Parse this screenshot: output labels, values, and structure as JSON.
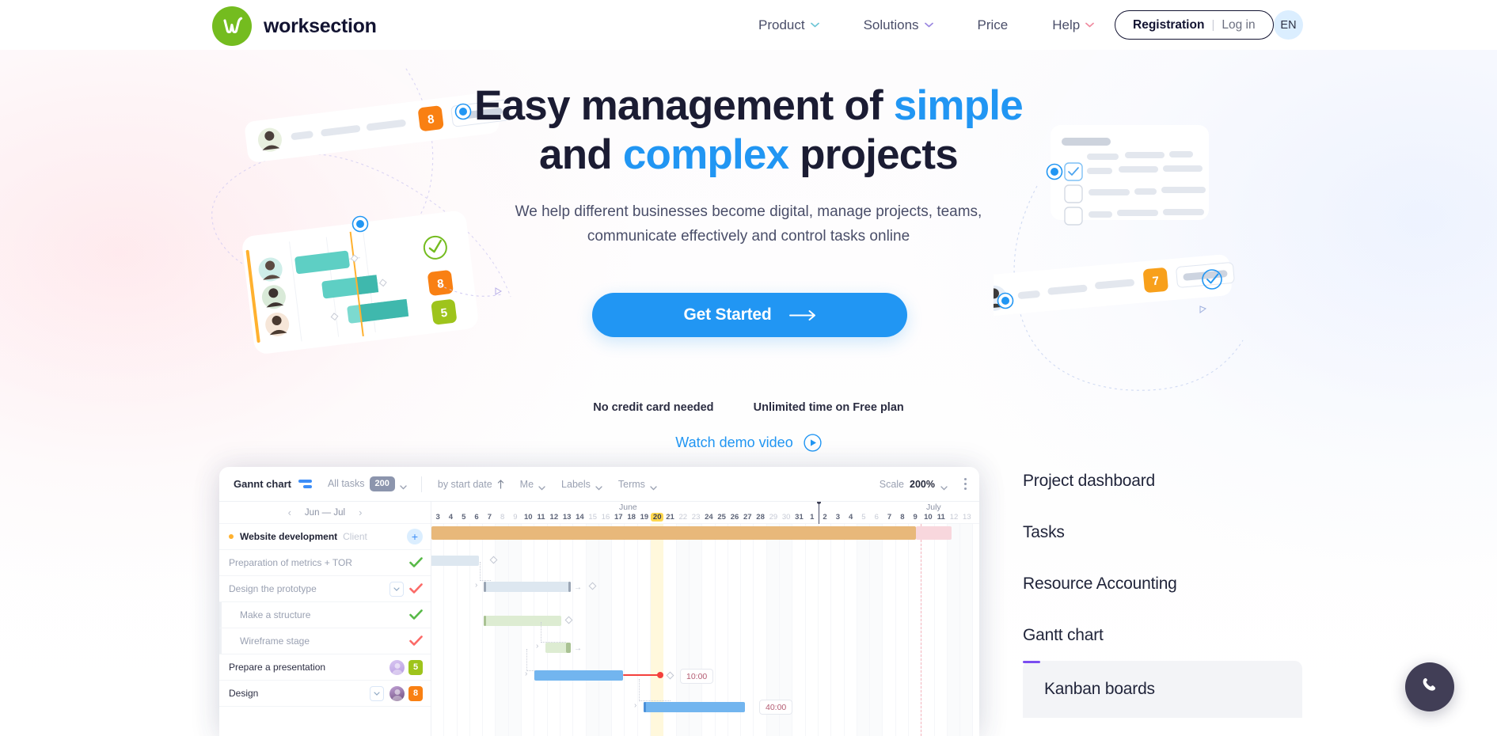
{
  "brand": {
    "name": "worksection",
    "logo_icon": "worksection-w-logo",
    "logo_color": "#74bc1f"
  },
  "nav": {
    "items": [
      {
        "label": "Product",
        "has_chevron": true,
        "chevron_color": "#6ec6d6"
      },
      {
        "label": "Solutions",
        "has_chevron": true,
        "chevron_color": "#9b87e0"
      },
      {
        "label": "Price",
        "has_chevron": false,
        "chevron_color": ""
      },
      {
        "label": "Help",
        "has_chevron": true,
        "chevron_color": "#f08ba0"
      }
    ],
    "registration_label": "Registration",
    "separator": "|",
    "login_label": "Log in",
    "language": "EN"
  },
  "hero": {
    "headline_part1": "Easy management of ",
    "headline_highlight1": "simple",
    "headline_part2": "and ",
    "headline_highlight2": "complex",
    "headline_part3": " projects",
    "highlight_color": "#2196f3",
    "subtitle_line1": "We help different businesses become digital, manage projects, teams,",
    "subtitle_line2": "communicate effectively and control tasks online",
    "cta_label": "Get Started",
    "cta_icon": "arrow-right-icon",
    "cta_color": "#2196f3",
    "note_left": "No credit card needed",
    "note_right": "Unlimited time on Free plan",
    "demo_label": "Watch demo video",
    "demo_icon": "play-circle-icon"
  },
  "illustration_left": {
    "badges": [
      "8",
      "8",
      "5"
    ],
    "badge_orange": "#f98013",
    "badge_green": "#9ec41c",
    "bar_color": "#5ecfc4",
    "check_color": "#74bc1f"
  },
  "illustration_right": {
    "badge": "7",
    "badge_color": "#f8a01b",
    "check_icon": "check-circle-icon"
  },
  "gantt": {
    "title": "Gannt chart",
    "title_icon": "gantt-bars-icon",
    "filters": [
      {
        "label": "All tasks",
        "badge": "200",
        "chevron": true
      },
      {
        "label": "by start date",
        "icon": "arrow-up-icon",
        "chevron": false
      },
      {
        "label": "Me",
        "chevron": true
      },
      {
        "label": "Labels",
        "chevron": true
      },
      {
        "label": "Terms",
        "chevron": true
      }
    ],
    "scale_label": "Scale",
    "scale_value": "200%",
    "menu_icon": "kebab-menu-icon",
    "date_nav": {
      "prev_icon": "chevron-left-icon",
      "range": "Jun — Jul",
      "next_icon": "chevron-right-icon"
    },
    "months": [
      {
        "name": "June"
      },
      {
        "name": "July"
      }
    ],
    "days": [
      {
        "n": "3",
        "w": false
      },
      {
        "n": "4",
        "w": false
      },
      {
        "n": "5",
        "w": false
      },
      {
        "n": "6",
        "w": false
      },
      {
        "n": "7",
        "w": false
      },
      {
        "n": "8",
        "w": true
      },
      {
        "n": "9",
        "w": true
      },
      {
        "n": "10",
        "w": false
      },
      {
        "n": "11",
        "w": false
      },
      {
        "n": "12",
        "w": false
      },
      {
        "n": "13",
        "w": false
      },
      {
        "n": "14",
        "w": false
      },
      {
        "n": "15",
        "w": true
      },
      {
        "n": "16",
        "w": true
      },
      {
        "n": "17",
        "w": false
      },
      {
        "n": "18",
        "w": false
      },
      {
        "n": "19",
        "w": false
      },
      {
        "n": "20",
        "w": false,
        "today": true
      },
      {
        "n": "21",
        "w": false
      },
      {
        "n": "22",
        "w": true
      },
      {
        "n": "23",
        "w": true
      },
      {
        "n": "24",
        "w": false
      },
      {
        "n": "25",
        "w": false
      },
      {
        "n": "26",
        "w": false
      },
      {
        "n": "27",
        "w": false
      },
      {
        "n": "28",
        "w": false
      },
      {
        "n": "29",
        "w": true
      },
      {
        "n": "30",
        "w": true
      },
      {
        "n": "31",
        "w": false
      },
      {
        "n": "1",
        "w": false
      },
      {
        "n": "2",
        "w": false
      },
      {
        "n": "3",
        "w": false
      },
      {
        "n": "4",
        "w": false
      },
      {
        "n": "5",
        "w": true
      },
      {
        "n": "6",
        "w": true
      },
      {
        "n": "7",
        "w": false
      },
      {
        "n": "8",
        "w": false
      },
      {
        "n": "9",
        "w": false
      },
      {
        "n": "10",
        "w": false
      },
      {
        "n": "11",
        "w": false
      },
      {
        "n": "12",
        "w": true
      },
      {
        "n": "13",
        "w": true
      }
    ],
    "rows": [
      {
        "name": "Website development",
        "client": "Client",
        "type": "project",
        "add_icon": "plus-icon"
      },
      {
        "name": "Preparation of metrics + TOR",
        "type": "task",
        "check": "green"
      },
      {
        "name": "Design the prototype",
        "type": "task",
        "check": "red",
        "caret": true
      },
      {
        "name": "Make a structure",
        "type": "subtask",
        "check": "green"
      },
      {
        "name": "Wireframe stage",
        "type": "subtask",
        "check": "red"
      },
      {
        "name": "Prepare a presentation",
        "type": "task",
        "avatar": true,
        "badge": "5",
        "badge_color": "green"
      },
      {
        "name": "Design",
        "type": "task",
        "caret": true,
        "avatar": true,
        "badge": "8",
        "badge_color": "orange"
      }
    ],
    "bar_labels": [
      "10:00",
      "40:00"
    ]
  },
  "sidebar": {
    "items": [
      {
        "label": "Project dashboard",
        "active": false
      },
      {
        "label": "Tasks",
        "active": false
      },
      {
        "label": "Resource Accounting",
        "active": false
      },
      {
        "label": "Gantt chart",
        "active": false
      },
      {
        "label": "Kanban boards",
        "active": true
      }
    ],
    "active_accent": "#7a4df0"
  },
  "fab": {
    "icon": "phone-icon",
    "color": "#413e56"
  }
}
